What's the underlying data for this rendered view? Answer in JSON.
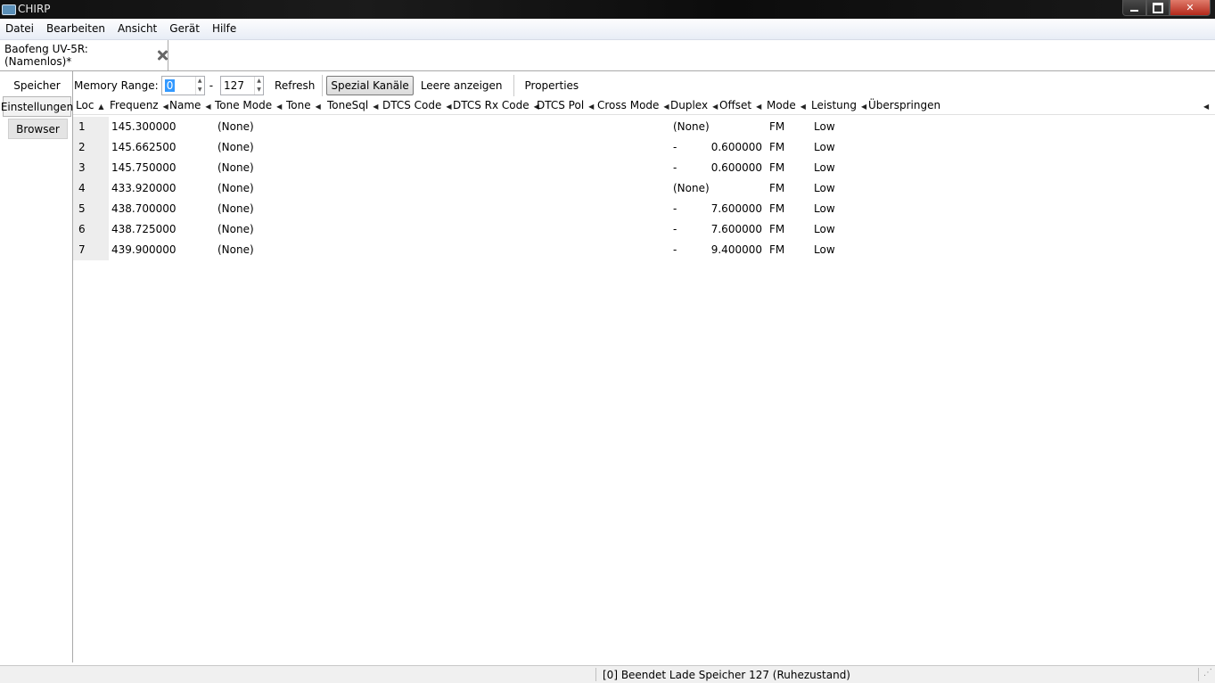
{
  "window": {
    "title": "CHIRP"
  },
  "menu": [
    "Datei",
    "Bearbeiten",
    "Ansicht",
    "Gerät",
    "Hilfe"
  ],
  "doc_tab": {
    "label": "Baofeng UV-5R: (Namenlos)*"
  },
  "side_tabs": {
    "speicher": "Speicher",
    "einstellungen": "Einstellungen",
    "browser": "Browser"
  },
  "toolbar": {
    "memory_range_label": "Memory Range:",
    "range_start": "0",
    "range_separator": "-",
    "range_end": "127",
    "refresh": "Refresh",
    "special_channels": "Spezial Kanäle",
    "show_empty": "Leere anzeigen",
    "properties": "Properties"
  },
  "table": {
    "columns": [
      "Loc",
      "Frequenz",
      "Name",
      "Tone Mode",
      "Tone",
      "ToneSql",
      "DTCS Code",
      "DTCS Rx Code",
      "DTCS Pol",
      "Cross Mode",
      "Duplex",
      "Offset",
      "Mode",
      "Leistung",
      "Überspringen"
    ],
    "rows": [
      {
        "loc": "1",
        "freq": "145.300000",
        "tone_mode": "(None)",
        "duplex": "(None)",
        "offset": "",
        "mode": "FM",
        "power": "Low"
      },
      {
        "loc": "2",
        "freq": "145.662500",
        "tone_mode": "(None)",
        "duplex": "-",
        "offset": "0.600000",
        "mode": "FM",
        "power": "Low"
      },
      {
        "loc": "3",
        "freq": "145.750000",
        "tone_mode": "(None)",
        "duplex": "-",
        "offset": "0.600000",
        "mode": "FM",
        "power": "Low"
      },
      {
        "loc": "4",
        "freq": "433.920000",
        "tone_mode": "(None)",
        "duplex": "(None)",
        "offset": "",
        "mode": "FM",
        "power": "Low"
      },
      {
        "loc": "5",
        "freq": "438.700000",
        "tone_mode": "(None)",
        "duplex": "-",
        "offset": "7.600000",
        "mode": "FM",
        "power": "Low"
      },
      {
        "loc": "6",
        "freq": "438.725000",
        "tone_mode": "(None)",
        "duplex": "-",
        "offset": "7.600000",
        "mode": "FM",
        "power": "Low"
      },
      {
        "loc": "7",
        "freq": "439.900000",
        "tone_mode": "(None)",
        "duplex": "-",
        "offset": "9.400000",
        "mode": "FM",
        "power": "Low"
      }
    ]
  },
  "status": {
    "message": "[0] Beendet Lade Speicher 127 (Ruhezustand)"
  }
}
